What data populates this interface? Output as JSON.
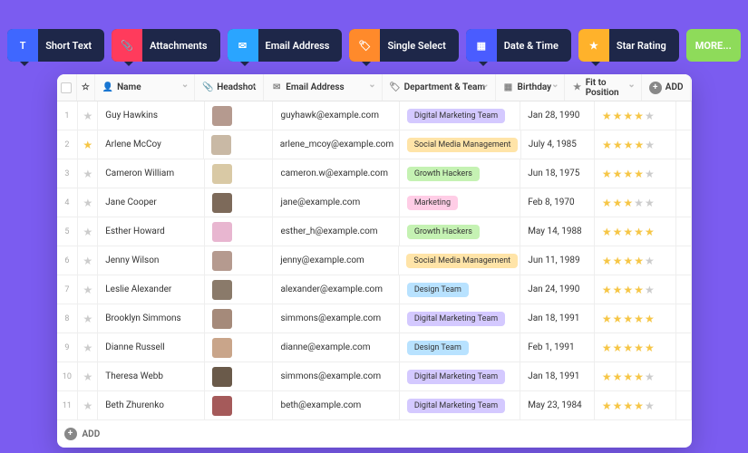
{
  "field_types": [
    {
      "label": "Short Text",
      "icon": "T",
      "icon_bg": "#3f67ff"
    },
    {
      "label": "Attachments",
      "icon": "📎",
      "icon_bg": "#ff3b5c"
    },
    {
      "label": "Email Address",
      "icon": "✉",
      "icon_bg": "#2aa5ff"
    },
    {
      "label": "Single Select",
      "icon": "🏷",
      "icon_bg": "#ff8a2b"
    },
    {
      "label": "Date & Time",
      "icon": "▦",
      "icon_bg": "#4a5cff"
    },
    {
      "label": "Star Rating",
      "icon": "★",
      "icon_bg": "#ffb22b"
    }
  ],
  "more_label": "MORE...",
  "columns": {
    "name": "Name",
    "headshot": "Headshot",
    "email": "Email Address",
    "dept": "Department & Team",
    "birthday": "Birthday",
    "fit": "Fit to Position",
    "add": "ADD"
  },
  "add_row_label": "ADD",
  "dept_colors": {
    "Digital Marketing Team": "#d4c9ff",
    "Social Media Management": "#ffe4a8",
    "Growth Hackers": "#c5f2b3",
    "Marketing": "#ffcde6",
    "Design Team": "#b8e2ff"
  },
  "rows": [
    {
      "idx": 1,
      "star": false,
      "name": "Guy Hawkins",
      "headshot": "#b59a8f",
      "email": "guyhawk@example.com",
      "dept": "Digital Marketing Team",
      "birthday": "Jan 28, 1990",
      "fit": 4
    },
    {
      "idx": 2,
      "star": true,
      "name": "Arlene McCoy",
      "headshot": "#c9b9a5",
      "email": "arlene_mcoy@example.com",
      "dept": "Social Media Management",
      "birthday": "July 4, 1985",
      "fit": 4
    },
    {
      "idx": 3,
      "star": false,
      "name": "Cameron William",
      "headshot": "#d9c9a5",
      "email": "cameron.w@example.com",
      "dept": "Growth Hackers",
      "birthday": "Jun 18, 1975",
      "fit": 4
    },
    {
      "idx": 4,
      "star": false,
      "name": "Jane Cooper",
      "headshot": "#7d6a5a",
      "email": "jane@example.com",
      "dept": "Marketing",
      "birthday": "Feb 8, 1970",
      "fit": 3
    },
    {
      "idx": 5,
      "star": false,
      "name": "Esther Howard",
      "headshot": "#e8b6d0",
      "email": "esther_h@example.com",
      "dept": "Growth Hackers",
      "birthday": "May 14, 1988",
      "fit": 5
    },
    {
      "idx": 6,
      "star": false,
      "name": "Jenny Wilson",
      "headshot": "#b59a8f",
      "email": "jenny@example.com",
      "dept": "Social Media Management",
      "birthday": "Jun 11, 1989",
      "fit": 4
    },
    {
      "idx": 7,
      "star": false,
      "name": "Leslie Alexander",
      "headshot": "#8a7a6a",
      "email": "alexander@example.com",
      "dept": "Design Team",
      "birthday": "Jan 24, 1990",
      "fit": 4
    },
    {
      "idx": 8,
      "star": false,
      "name": "Brooklyn Simmons",
      "headshot": "#a58a7a",
      "email": "simmons@example.com",
      "dept": "Digital Marketing Team",
      "birthday": "Jan 18, 1991",
      "fit": 5
    },
    {
      "idx": 9,
      "star": false,
      "name": "Dianne Russell",
      "headshot": "#c9a58a",
      "email": "dianne@example.com",
      "dept": "Design Team",
      "birthday": "Feb 1, 1991",
      "fit": 5
    },
    {
      "idx": 10,
      "star": false,
      "name": "Theresa Webb",
      "headshot": "#6a5a4a",
      "email": "simmons@example.com",
      "dept": "Digital Marketing Team",
      "birthday": "Jan 18, 1991",
      "fit": 4
    },
    {
      "idx": 11,
      "star": false,
      "name": "Beth Zhurenko",
      "headshot": "#a55a5a",
      "email": "beth@example.com",
      "dept": "Digital Marketing Team",
      "birthday": "May 23, 1984",
      "fit": 4
    }
  ]
}
